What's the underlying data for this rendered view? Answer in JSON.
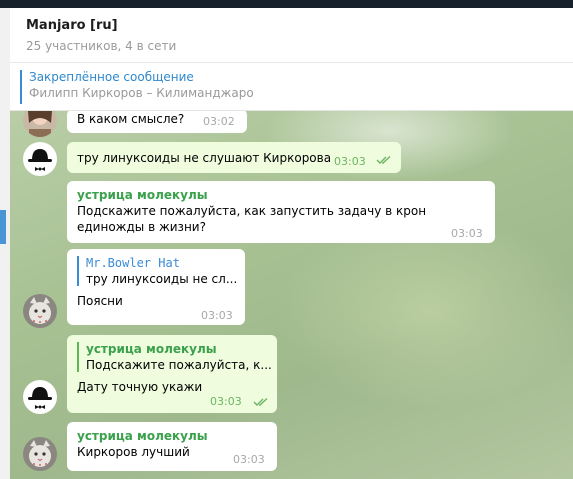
{
  "header": {
    "title": "Manjaro [ru]",
    "subtitle": "25 участников, 4 в сети"
  },
  "pinned": {
    "title": "Закреплённое сообщение",
    "text": "Филипп Киркоров – Килиманджаро"
  },
  "messages": [
    {
      "text": "В каком смысле?",
      "time": "03:02"
    },
    {
      "text": "тру линуксоиды не слушают Киркорова",
      "time": "03:03"
    },
    {
      "sender": "устрица молекулы",
      "text": "Подскажите пожалуйста, как запустить задачу в крон единожды в жизни?",
      "time": "03:03"
    },
    {
      "reply_name": "Mr.Bowler Hat",
      "reply_text": "тру линуксоиды не сл...",
      "text": "Поясни",
      "time": "03:03"
    },
    {
      "reply_name": "устрица молекулы",
      "reply_text": "Подскажите пожалуйста, к...",
      "text": "Дату точную укажи",
      "time": "03:03"
    },
    {
      "sender": "устрица молекулы",
      "text": "Киркоров лучший",
      "time": "03:03"
    }
  ],
  "colors": {
    "accent": "#3a8bd6",
    "sender_green": "#3ba14c",
    "outgoing_bubble": "#effdde",
    "check_green": "#6cb562"
  },
  "icons": {
    "read_receipt": "double-check-icon"
  }
}
